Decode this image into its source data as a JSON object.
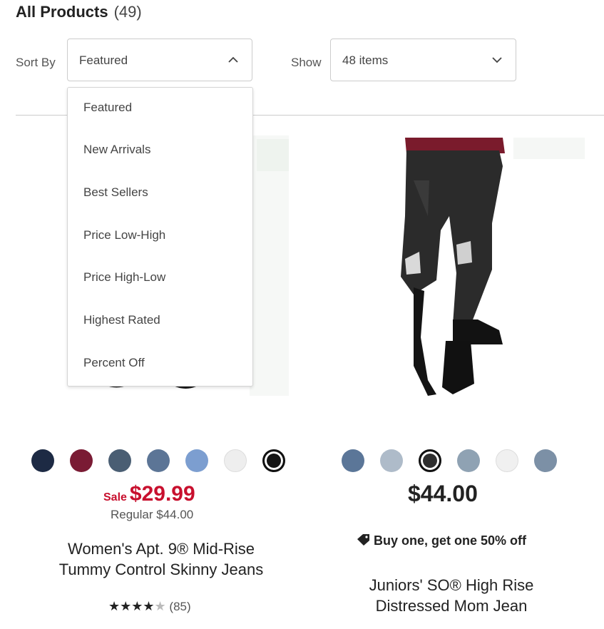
{
  "header": {
    "title": "All Products",
    "count": "(49)"
  },
  "sort": {
    "label": "Sort By",
    "value": "Featured",
    "options": [
      "Featured",
      "New Arrivals",
      "Best Sellers",
      "Price Low-High",
      "Price High-Low",
      "Highest Rated",
      "Percent Off"
    ]
  },
  "show": {
    "label": "Show",
    "value": "48 items"
  },
  "products": [
    {
      "swatches": [
        "#1d2a44",
        "#7a1b34",
        "#4a5e73",
        "#5c7596",
        "#7c9ed0",
        "#eeeeee",
        "#141414"
      ],
      "selected_swatch": 6,
      "sale_label": "Sale",
      "sale_price": "$29.99",
      "regular": "Regular $44.00",
      "name_line1": "Women's Apt. 9® Mid-Rise",
      "name_line2": "Tummy Control Skinny Jeans",
      "stars": "★★★★",
      "half_star": "★",
      "reviews": "(85)"
    },
    {
      "swatches": [
        "#5b7698",
        "#aebbc9",
        "#2e2e2e",
        "#8fa2b3",
        "#f0f0f0",
        "#7c90a6"
      ],
      "selected_swatch": 2,
      "price": "$44.00",
      "promo": "Buy one, get one 50% off",
      "name_line1": "Juniors' SO® High Rise",
      "name_line2": "Distressed Mom Jean"
    }
  ]
}
